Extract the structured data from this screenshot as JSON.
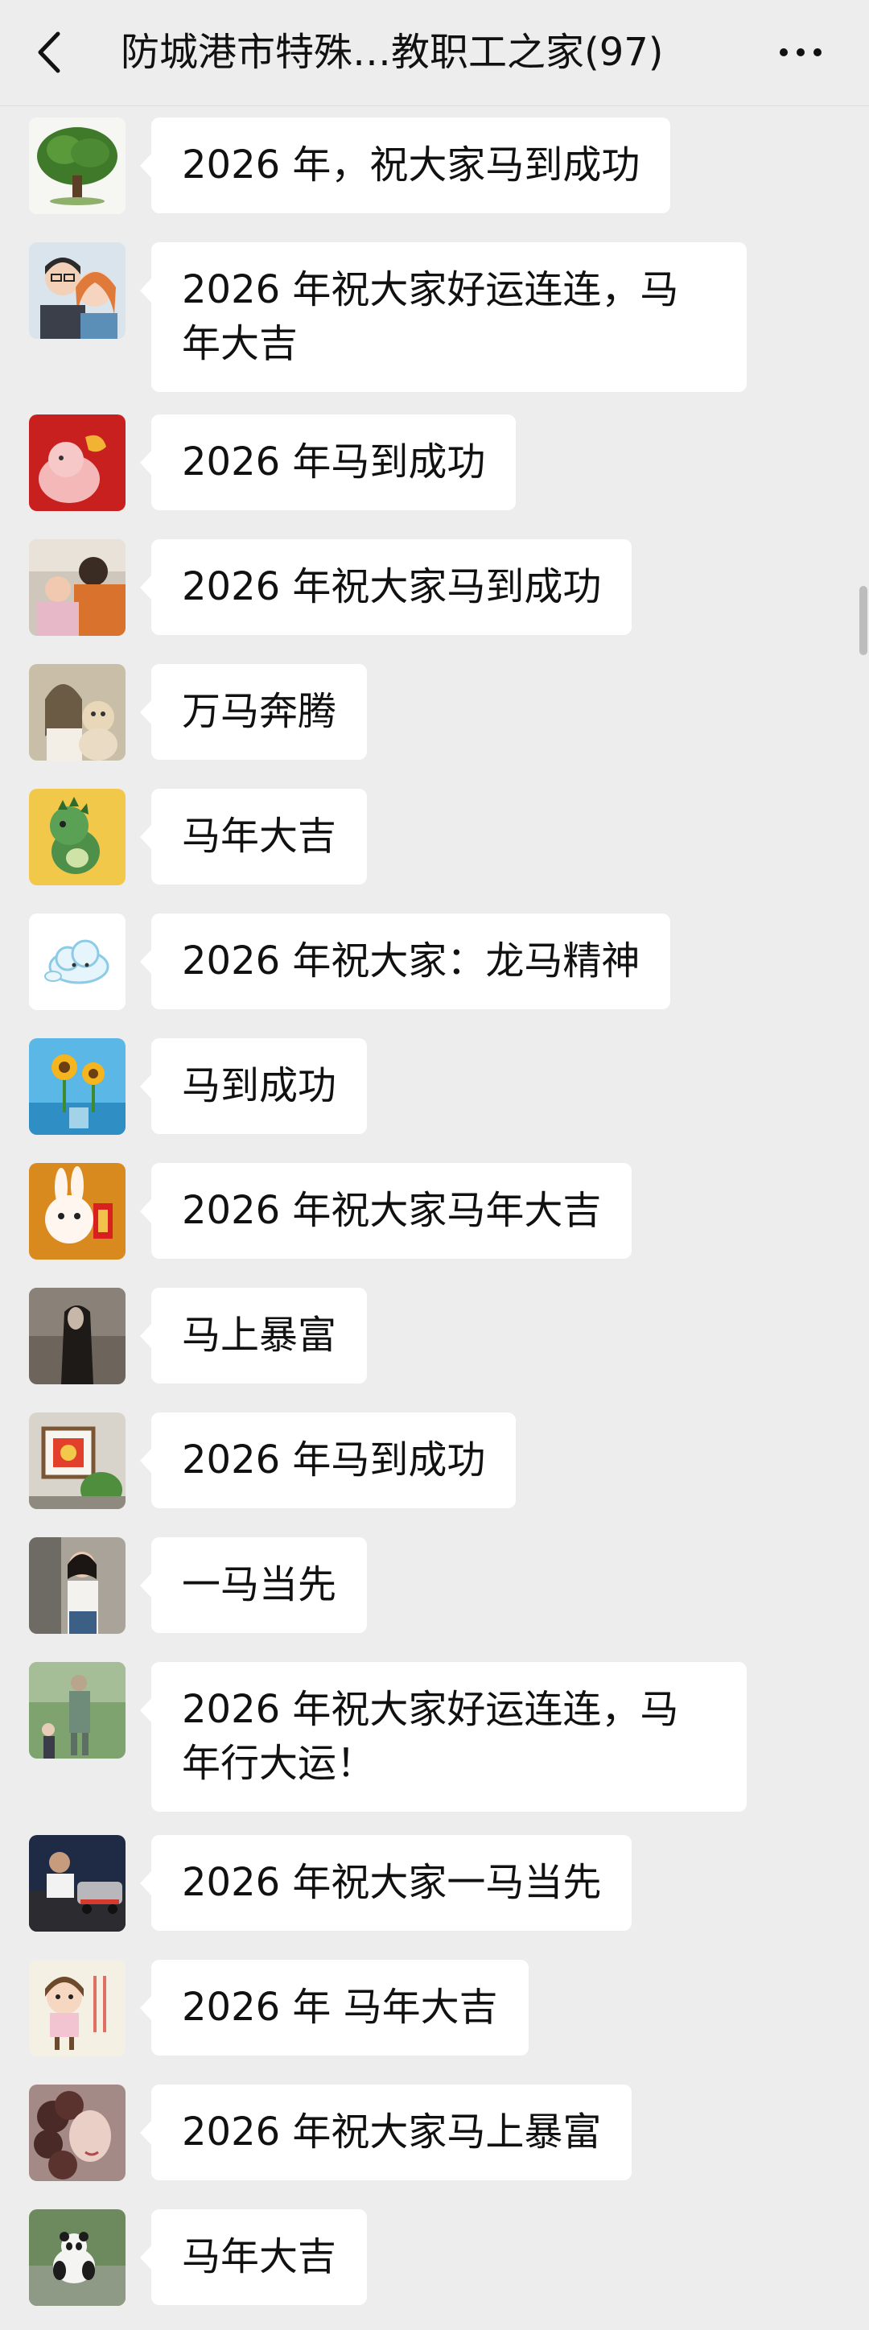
{
  "header": {
    "title": "防城港市特殊…教职工之家(97)"
  },
  "messages": [
    {
      "text": "2026 年，祝大家马到成功",
      "avatar": "tree-avatar"
    },
    {
      "text": "2026 年祝大家好运连连，马年大吉",
      "avatar": "couple-avatar"
    },
    {
      "text": "2026 年马到成功",
      "avatar": "red-cartoon-avatar"
    },
    {
      "text": "2026 年祝大家马到成功",
      "avatar": "family-avatar"
    },
    {
      "text": "万马奔腾",
      "avatar": "girl-dog-avatar"
    },
    {
      "text": "马年大吉",
      "avatar": "dinosaur-avatar"
    },
    {
      "text": "2026 年祝大家：龙马精神",
      "avatar": "cloud-avatar"
    },
    {
      "text": "马到成功",
      "avatar": "sunflower-avatar"
    },
    {
      "text": "2026 年祝大家马年大吉",
      "avatar": "rabbit-avatar"
    },
    {
      "text": "马上暴富",
      "avatar": "dark-portrait-avatar"
    },
    {
      "text": "2026 年马到成功",
      "avatar": "window-avatar"
    },
    {
      "text": "一马当先",
      "avatar": "woman-avatar"
    },
    {
      "text": "2026 年祝大家好运连连，马年行大运！",
      "avatar": "statue-avatar"
    },
    {
      "text": "2026 年祝大家一马当先",
      "avatar": "man-car-avatar"
    },
    {
      "text": "2026 年 马年大吉",
      "avatar": "cartoon-girl-avatar"
    },
    {
      "text": "2026 年祝大家马上暴富",
      "avatar": "curly-hair-avatar"
    },
    {
      "text": "马年大吉",
      "avatar": "panda-avatar"
    }
  ],
  "colors": {
    "background": "#EDEDED",
    "bubble": "#FFFFFF",
    "text": "#111111"
  }
}
